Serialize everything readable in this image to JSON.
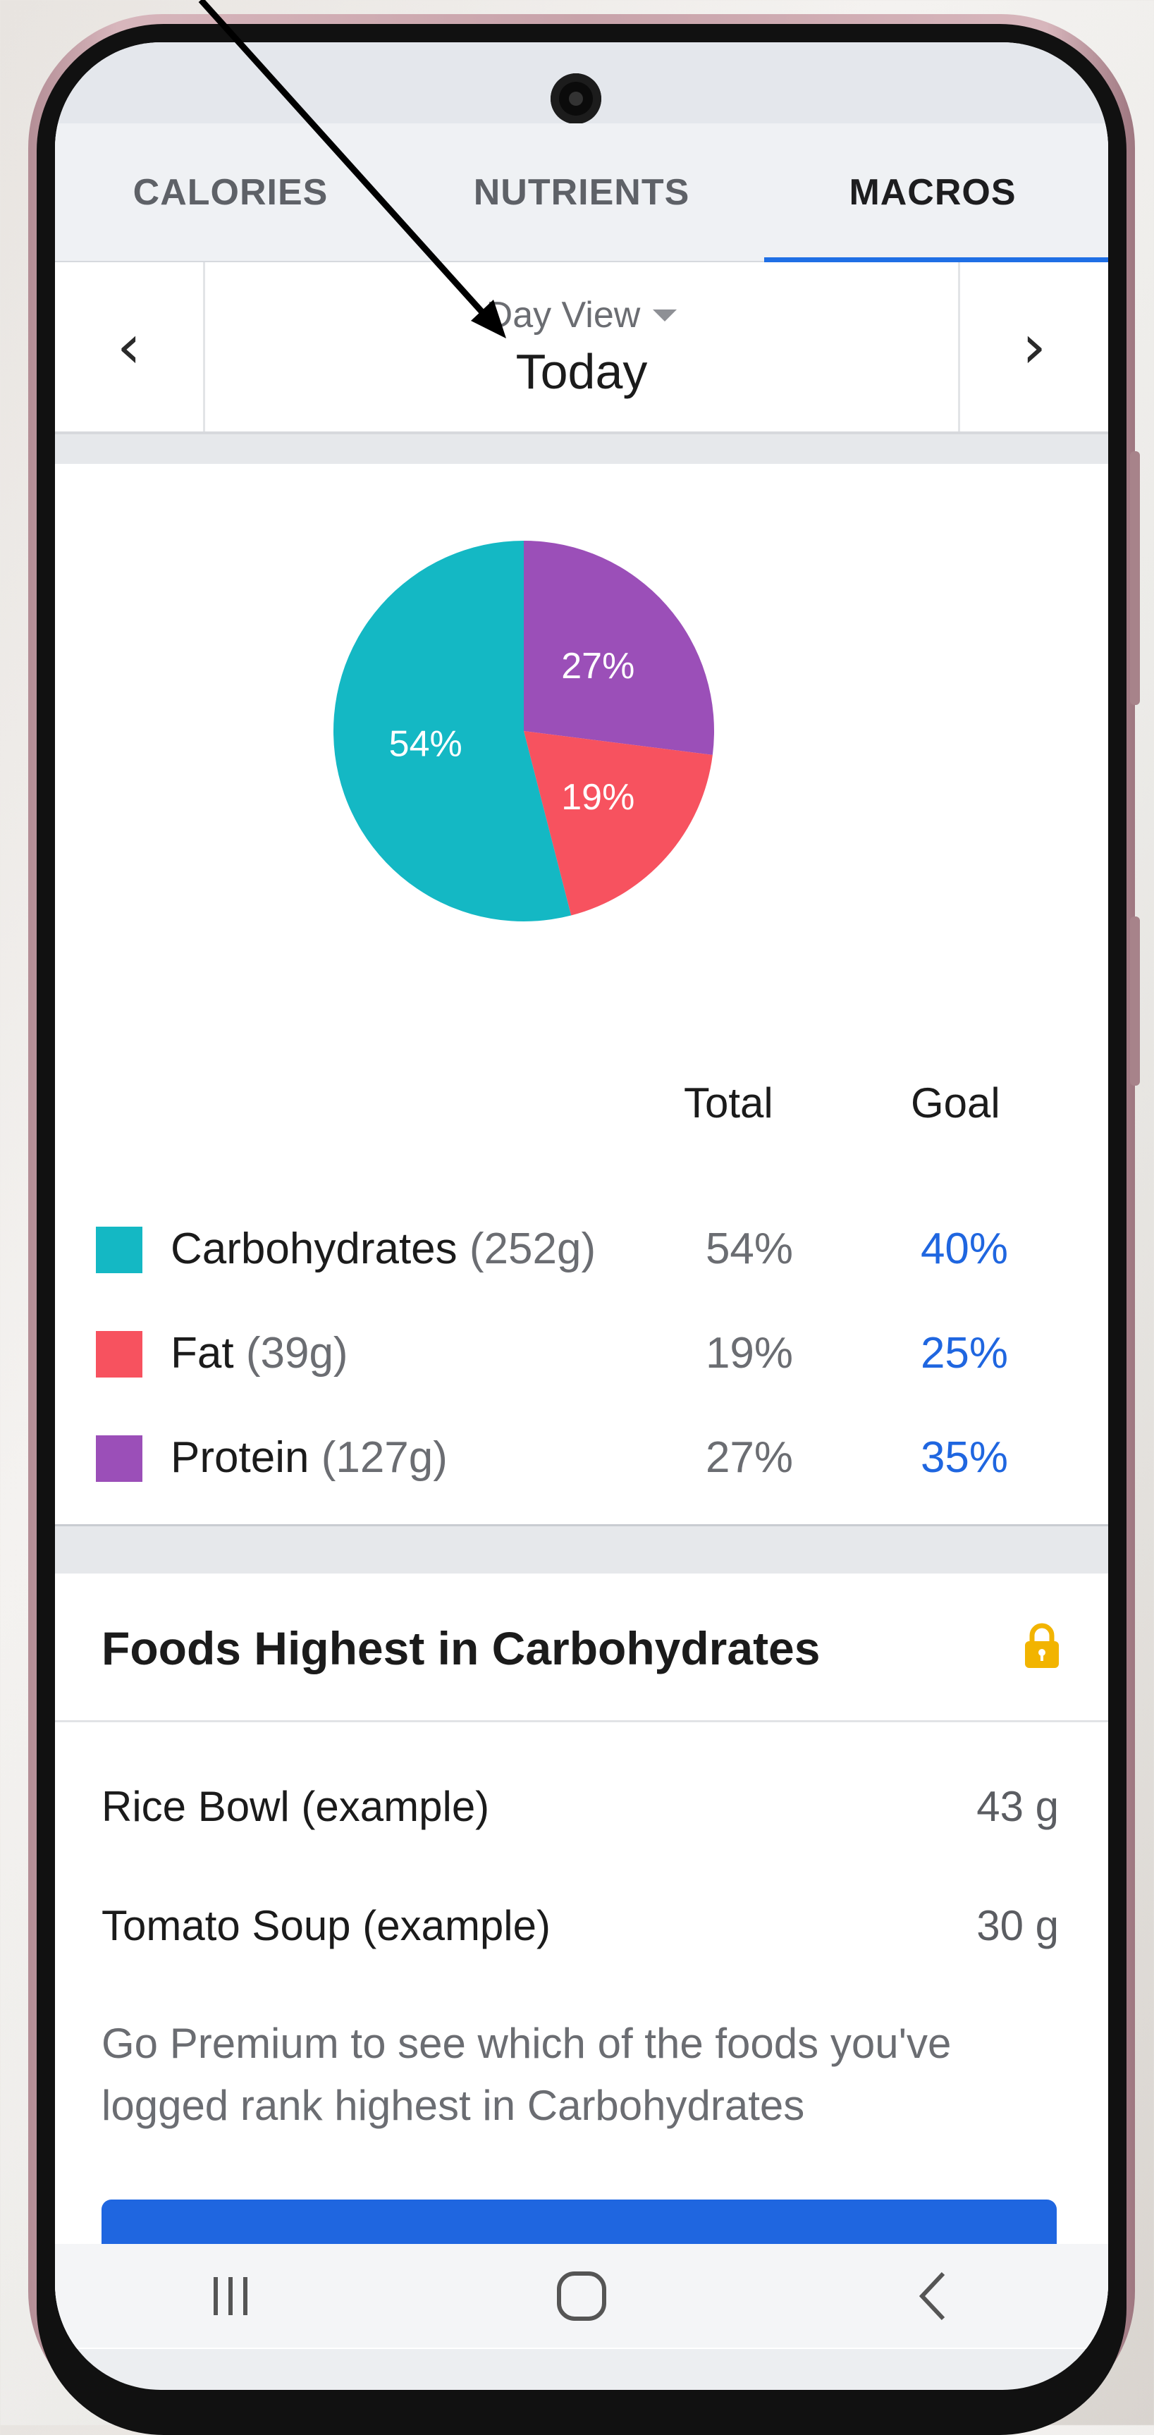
{
  "tabs": [
    {
      "label": "CALORIES",
      "active": false
    },
    {
      "label": "NUTRIENTS",
      "active": false
    },
    {
      "label": "MACROS",
      "active": true
    }
  ],
  "date_nav": {
    "prev_icon": "chevron-left-icon",
    "next_icon": "chevron-right-icon",
    "view_label": "Day View",
    "date_label": "Today"
  },
  "chart_data": {
    "type": "pie",
    "slices": [
      {
        "label": "Protein",
        "value": 27,
        "display": "27%",
        "color": "#9b4fb8"
      },
      {
        "label": "Fat",
        "value": 19,
        "display": "19%",
        "color": "#f7525f"
      },
      {
        "label": "Carbohydrates",
        "value": 54,
        "display": "54%",
        "color": "#14b8c4"
      }
    ],
    "start_angle_deg": 0,
    "direction": "clockwise"
  },
  "macros_table": {
    "header_total": "Total",
    "header_goal": "Goal",
    "rows": [
      {
        "name": "Carbohydrates",
        "grams": "(252g)",
        "total": "54%",
        "goal": "40%",
        "color": "#14b8c4"
      },
      {
        "name": "Fat",
        "grams": "(39g)",
        "total": "19%",
        "goal": "25%",
        "color": "#f7525f"
      },
      {
        "name": "Protein",
        "grams": "(127g)",
        "total": "27%",
        "goal": "35%",
        "color": "#9b4fb8"
      }
    ]
  },
  "foods": {
    "title": "Foods Highest in Carbohydrates",
    "lock_icon": "lock-icon",
    "items": [
      {
        "name": "Rice Bowl (example)",
        "value": "43 g"
      },
      {
        "name": "Tomato Soup (example)",
        "value": "30 g"
      }
    ],
    "premium_text": "Go Premium to see which of the foods you've logged rank highest in Carbohydrates"
  },
  "system_nav": {
    "recents_icon": "recents-icon",
    "home_icon": "home-icon",
    "back_icon": "back-icon"
  },
  "colors": {
    "accent": "#1f66e0",
    "carbs": "#14b8c4",
    "fat": "#f7525f",
    "protein": "#9b4fb8"
  }
}
